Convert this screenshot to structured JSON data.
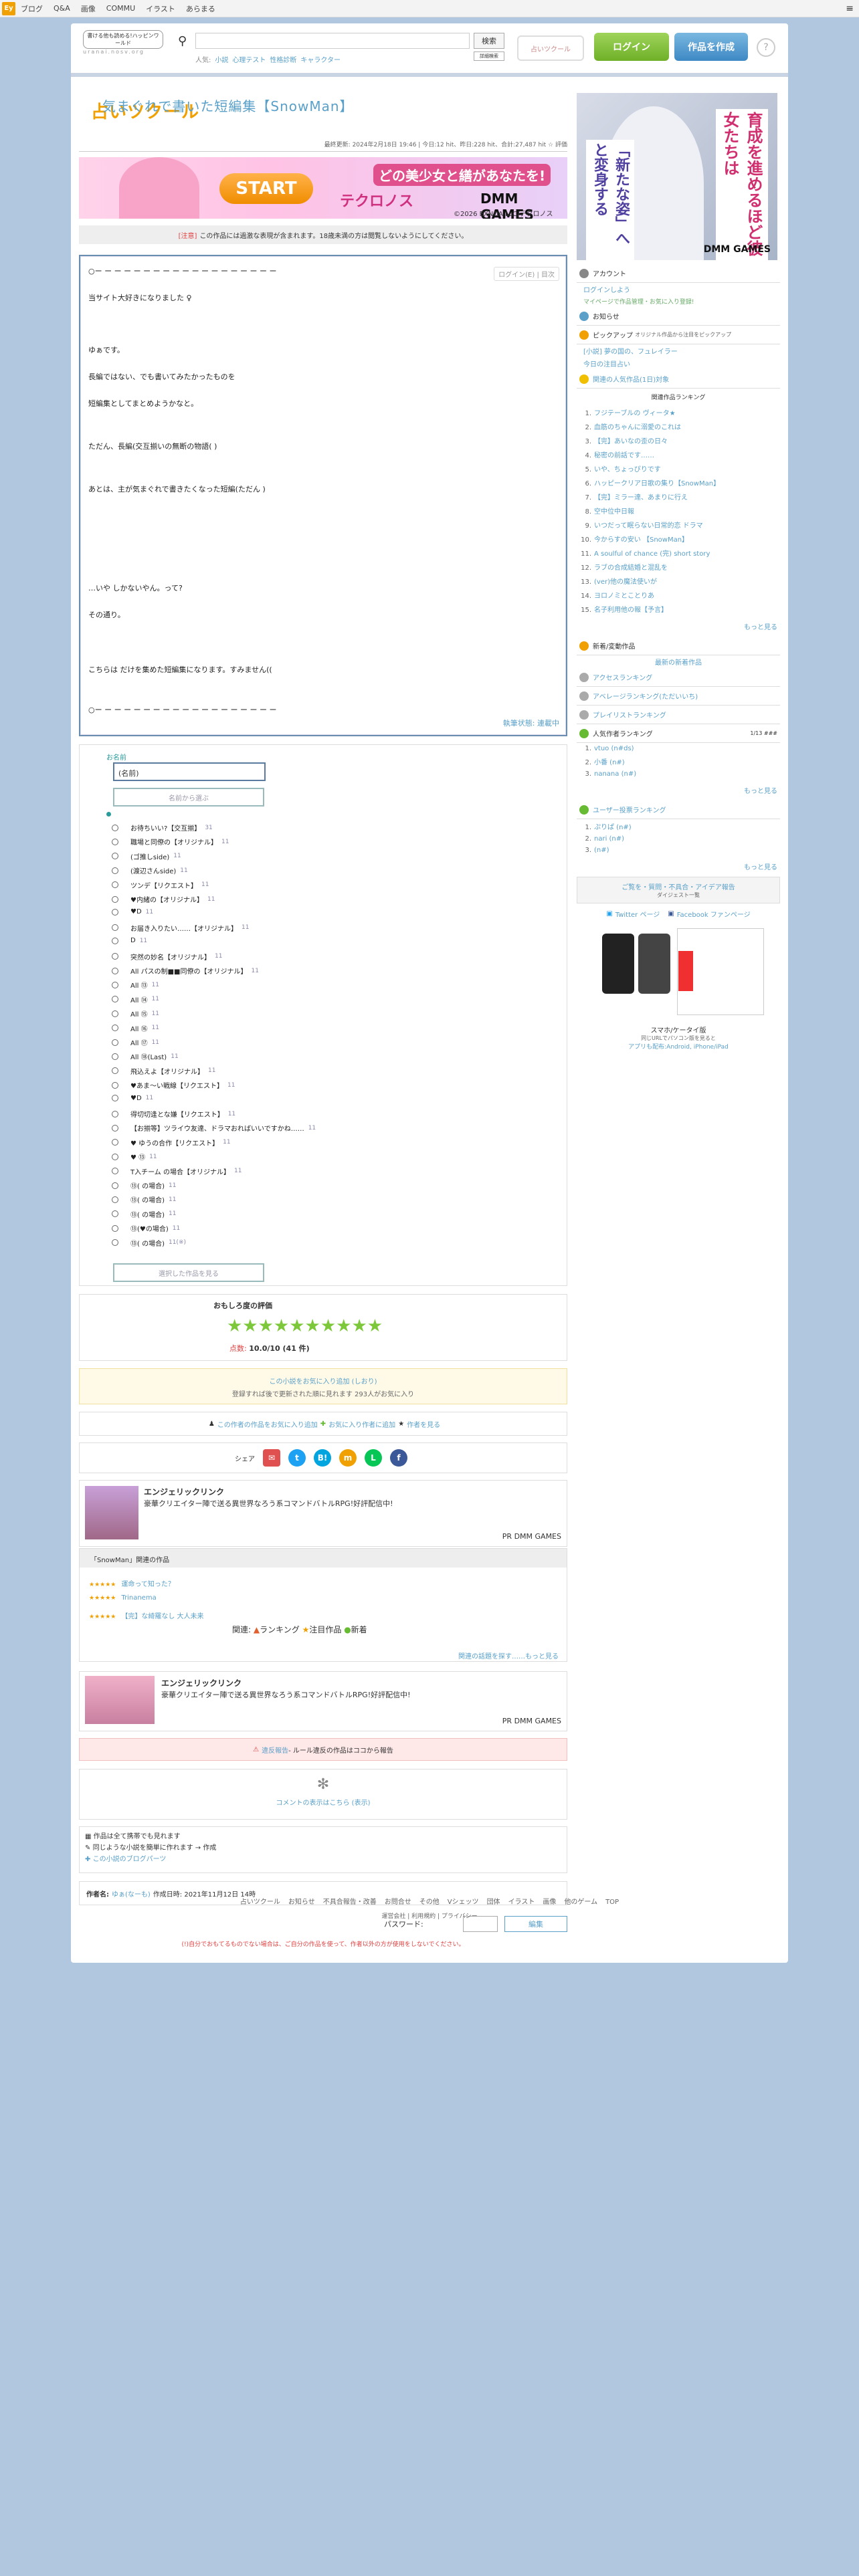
{
  "topbar": {
    "logo": "Ey",
    "nav": [
      "ブログ",
      "Q&A",
      "画像",
      "COMMU",
      "イラスト",
      "あらまる"
    ],
    "menu": "≡"
  },
  "header": {
    "tagline": "書ける他も読める!ハッピンワールド",
    "logo": "占いツクール",
    "sub": "uranai.nosv.org",
    "search_button": "検索",
    "search_detail": "詳細検索",
    "keywords_label": "人気:",
    "keywords": [
      "小説",
      "心理テスト",
      "性格診断",
      "キャラクター"
    ],
    "badge": "占いツクール",
    "login": "ログイン",
    "works": "作品を作成",
    "help": "?"
  },
  "work": {
    "title": "気まぐれで書いた短編集【SnowMan】",
    "stats": "最終更新: 2024年2月18日 19:46 | 今日:12 hit、昨日:228 hit、合計:27,487 hit ☆ 評価",
    "notice_tag": "[注意]",
    "notice": "この作品には過激な表現が含まれます。18歳未満の方は閲覧しないようにしてください。",
    "banner_msg": "どの美少女と繕があなたを!",
    "banner_start": "START",
    "banner_logo": "テクロノス",
    "banner_dmm": "DMM GAMES",
    "banner_copy": "©2026 EXNOA LLC/テクロノス",
    "topright": "ログイン(E) | 目次",
    "lines": [
      "○ー ー ー ー ー ー ー ー ー ー ー ー ー ー ー ー ー ー ー",
      "当サイト大好きになりました  ♀",
      "ゆぁです。",
      "長編ではない、でも書いてみたかったものを",
      "短編集としてまとめようかなと。",
      "ただん、長編(交互揃いの無断の物語( )",
      "あとは、主が気まぐれで書きたくなった短編(ただん )",
      "…いや  しかないやん。って?",
      "その通り。",
      "こちらは  だけを集めた短編集になります。すみません(( ",
      "○ー ー ー ー ー ー ー ー ー ー ー ー ー ー ー ー ー ー ー"
    ],
    "footer_link": "執筆状態: 連載中"
  },
  "vote": {
    "name_label": "お名前",
    "name_value": "(名前)",
    "confirm": "名前から選ぶ",
    "options": [
      [
        "お待ちいい?【交互揃】",
        "31"
      ],
      [
        "職場と同僚の【オリジナル】",
        "11"
      ],
      [
        "(ゴ推しside)",
        "11"
      ],
      [
        "(渡辺さんside)",
        "11"
      ],
      [
        "ツンデ【リクエスト】",
        "11"
      ],
      [
        "♥内緒の【オリジナル】",
        "11"
      ],
      [
        "♥D",
        "11"
      ],
      [
        "お届き入りたい……【オリジナル】",
        "11"
      ],
      [
        "D",
        "11"
      ],
      [
        "  突然の妙名【オリジナル】",
        "11"
      ],
      [
        "All パスの制■■同僚の【オリジナル】",
        "11"
      ],
      [
        "All ⑬",
        "11"
      ],
      [
        "All ⑭",
        "11"
      ],
      [
        "All ⑮",
        "11"
      ],
      [
        "All ⑯",
        "11"
      ],
      [
        "All ⑰",
        "11"
      ],
      [
        "All ⑱(Last)",
        "11"
      ],
      [
        "  飛込えよ【オリジナル】",
        "11"
      ],
      [
        "♥あま～い戦線【リクエスト】",
        "11"
      ],
      [
        "♥D",
        "11"
      ],
      [
        "  得切切逢とな嫌【リクエスト】",
        "11"
      ],
      [
        "【お揃等】ツライウ友達、ドラマおればいいですかね……",
        "11"
      ],
      [
        "♥  ゆうの合作【リクエスト】",
        "11"
      ],
      [
        "♥  ⑬",
        "11"
      ],
      [
        "T入チーム  の場合【オリジナル】",
        "11"
      ],
      [
        "⑬(  の場合)",
        "11"
      ],
      [
        "⑬(  の場合)",
        "11"
      ],
      [
        "⑬(  の場合)",
        "11"
      ],
      [
        "⑬(♥の場合)",
        "11"
      ],
      [
        "⑬(  の場合)",
        "11(※)"
      ]
    ],
    "submit": "選択した作品を見る"
  },
  "rating": {
    "heading": "おもしろ度の評価",
    "stars": "★★★★★★★★★★",
    "label": "点数:",
    "value": "10.0/10 (41 件)"
  },
  "fav": {
    "line1": "この小説をお気に入り追加 (しおり)",
    "line2": "登録すれば後で更新された順に見れます 293人がお気に入り"
  },
  "author_links": [
    "この作者の作品をお気に入り追加",
    "お気に入り作者に追加",
    "作者を見る"
  ],
  "share_label": "シェア",
  "ad1": {
    "title": "エンジェリックリンク",
    "desc": "豪華クリエイター陣で送る異世界なろう系コマンドバトルRPG!好評配信中!",
    "pr": "PR DMM GAMES"
  },
  "related": {
    "heading": "「SnowMan」関連の作品",
    "items": [
      "運命って知った？",
      "Trinanema",
      "【完】な綺羅なし 大人未来"
    ],
    "stars": "★★★★★",
    "mark": "関連:",
    "tabs": [
      "ランキング",
      "注目作品",
      "新着"
    ],
    "more": "関連の話題を探す……もっと見る"
  },
  "ad2": {
    "title": "エンジェリックリンク",
    "desc": "豪華クリエイター陣で送る異世界なろう系コマンドバトルRPG!好評配信中!",
    "pr": "PR DMM GAMES"
  },
  "report": {
    "link": "違反報告",
    "text": "- ルール違反の作品はココから報告"
  },
  "comments": {
    "spinner": "✻",
    "text": "コメントの表示はこちら (表示)"
  },
  "links": [
    "作品は全て携帯でも見れます",
    "同じような小説を簡単に作れます → 作成",
    "この小説のブログパーツ"
  ],
  "author": {
    "label": "作者名:",
    "name": "ゆぁ(なーも)",
    "date": "作成日時: 2021年11月12日 14時"
  },
  "password": {
    "label": "パスワード:",
    "button": "編集"
  },
  "warning": "(!)自分でおもてるものでない場合は、ご自分の作品を使って、作者以外の方が使用をしないでください。",
  "footer": {
    "row1": [
      "占いツクール",
      "お知らせ",
      "不具合報告・改善",
      "お問合せ",
      "その他",
      "Vシェッツ",
      "団体",
      "イラスト",
      "画像",
      "他のゲーム",
      "TOP"
    ],
    "row2": "運営会社 | 利用規約 | プライバシー"
  },
  "sidebar": {
    "ad": {
      "v1": "育成を進めるほど彼女たちは",
      "v2": "「新たな姿」へと変身する",
      "dmm": "DMM GAMES"
    },
    "account": "アカウント",
    "login": "ログインしよう",
    "login_sub": "マイページで作品管理・お気に入り登録!",
    "news": "お知らせ",
    "pickup": "ピックアップ",
    "pickup_sub": "オリジナル作品から注目をピックアップ",
    "pickup_items": [
      "[小説] 夢の国の、フュレイラー",
      "今日の注目占い"
    ],
    "ranking_head": "関連の人気作品(1日)対象",
    "ranking_sub": "関連作品ランキング",
    "ranking": [
      "フジテーブルの ヴィータ★",
      "血筋のちゃんに溺愛のこれは",
      "【完】あいなの歪の日々",
      "秘密の前話です……",
      "いや、ちょっぴりです",
      "ハッピークリア日歌の集り【SnowMan】",
      "【完】ミラー達、あまりに行え",
      "空中位中日報",
      "いつだって眠らない日常的恋 ドラマ",
      "今からすの安い 【SnowMan】",
      "A soulful of chance (完) short story",
      "ラブの合成結婚と混乱を",
      "(ver)他の魔法使いが",
      "ヨロノミとことりあ",
      "名子利用他の報【予言】"
    ],
    "more": "もっと見る",
    "newwork": "新着/変動作品",
    "newwork_sub": "最新の新着作品",
    "attention": "アクセスランキング",
    "attention2": "アベレージランキング(ただいいち)",
    "attention3": "プレイリストランキング",
    "popular_head": "人気作者ランキング",
    "popular_sub": "1/13 ###",
    "popular": [
      "vtuo (n#ds)",
      "小番 (n#)",
      "nanana (n#)"
    ],
    "user_rank": "ユーザー投票ランキング",
    "user_rank_items": [
      "ぷりぱ (n#)",
      "nari (n#)",
      "(n#)"
    ],
    "create": "ご覧を・質問・不具合・アイデア報告",
    "create_sub": "ダイジェスト一覧",
    "twitter": "Twitter ページ",
    "facebook": "Facebook ファンページ",
    "mobile_label": "スマホ/ケータイ版",
    "mobile_sub": "同じURLでパソコン版を見ると",
    "mobile_apps": "アプリも配布:Android, iPhone/iPad"
  }
}
